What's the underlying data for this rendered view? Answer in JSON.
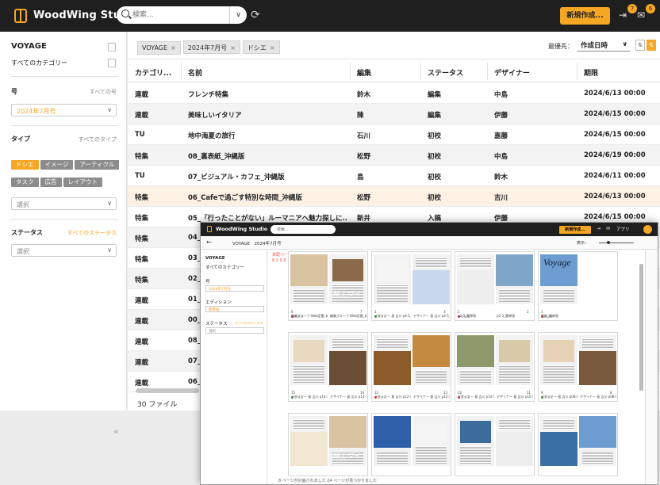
{
  "topbar": {
    "brand": "WoodWing Studio",
    "search_placeholder": "検索...",
    "new_button": "新規作成...",
    "badge_a": "7",
    "badge_b": "6"
  },
  "sidebar": {
    "title": "VOYAGE",
    "all_categories": "すべてのカテゴリー",
    "issue_label": "号",
    "issue_link": "すべての号",
    "issue_value": "2024年7月号",
    "type_label": "タイプ",
    "type_link": "すべてのタイプ",
    "type_chips": [
      {
        "label": "ドシエ",
        "active": true
      },
      {
        "label": "イメージ",
        "active": false
      },
      {
        "label": "アーティクル",
        "active": false
      },
      {
        "label": "タスク",
        "active": false
      },
      {
        "label": "広告",
        "active": false
      },
      {
        "label": "レイアウト",
        "active": false
      }
    ],
    "type_select_placeholder": "選択",
    "status_label": "ステータス",
    "status_link": "すべてのステータス",
    "status_select_placeholder": "選択"
  },
  "filters": [
    "VOYAGE",
    "2024年7月号",
    "ドシエ"
  ],
  "sort": {
    "label": "最優先：",
    "value": "作成日時"
  },
  "table": {
    "headers": [
      "カテゴリ...",
      "名前",
      "編集",
      "ステータス",
      "デザイナー",
      "期限"
    ],
    "rows": [
      [
        "連載",
        "フレンチ特集",
        "鈴木",
        "編集",
        "中島",
        "2024/6/13 00:00"
      ],
      [
        "連載",
        "美味しいイタリア",
        "陳",
        "編集",
        "伊藤",
        "2024/6/15 00:00"
      ],
      [
        "TU",
        "地中海夏の旅行",
        "石川",
        "初校",
        "嘉藤",
        "2024/6/15 00:00"
      ],
      [
        "特集",
        "08_裏表紙_沖縄版",
        "松野",
        "初校",
        "中島",
        "2024/6/19 00:00"
      ],
      [
        "TU",
        "07_ビジュアル・カフェ_沖縄版",
        "島",
        "初校",
        "鈴木",
        "2024/6/11 00:00"
      ],
      [
        "特集",
        "06_Cafeで過ごす特別な時間_沖縄版",
        "松野",
        "初校",
        "吉川",
        "2024/6/13 00:00"
      ],
      [
        "特集",
        "05_「行ったことがない」ルーマニアへ魅力探しに...",
        "新井",
        "入稿",
        "伊藤",
        "2024/6/15 00:00"
      ],
      [
        "特集",
        "04_",
        "",
        "",
        "",
        ""
      ],
      [
        "特集",
        "03_",
        "",
        "",
        "",
        ""
      ],
      [
        "特集",
        "02_",
        "",
        "",
        "",
        ""
      ],
      [
        "連載",
        "01_",
        "",
        "",
        "",
        ""
      ],
      [
        "連載",
        "00_",
        "",
        "",
        "",
        ""
      ],
      [
        "連載",
        "08_",
        "",
        "",
        "",
        ""
      ],
      [
        "連載",
        "07_",
        "",
        "",
        "",
        ""
      ],
      [
        "連載",
        "06_",
        "",
        "",
        "",
        ""
      ]
    ]
  },
  "file_count": "30 ファイル",
  "layout_window": {
    "brand": "WoodWing Studio",
    "search_placeholder": "検索...",
    "new_button": "新規作成...",
    "apps": "アプリ",
    "breadcrumb": "VOYAGE　2024年7月号",
    "display": "表示：",
    "side_title": "VOYAGE",
    "side_categories": "すべてのカテゴリー",
    "issue_label": "号",
    "issue_value": "2024年7月号",
    "edition_label": "エディション",
    "edition_value": "標準版",
    "status_label": "ステータス",
    "status_link": "すべてのステータス",
    "status_placeholder": "選択",
    "grid_label_1": "未配ページ",
    "grid_label_2": "8 2 0 8",
    "cover_title": "Voyage",
    "status_line": "8 ページが計画されました 24 ページが見つかりました",
    "spreads": [
      {
        "left_num": "6",
        "right_num": "7",
        "caption_left": "編集グループ\nWeb定番_bodyでの出力",
        "caption_right": "編集グループ\nWeb定番_bodyでの出力"
      },
      {
        "left_num": "2",
        "right_num": "3",
        "caption_left": "デザイナー 島 吉川\np4-5_簡単版",
        "caption_right": "デザイナー 島 吉川\np4-5_簡単版"
      },
      {
        "left_num": "2",
        "right_num": "3",
        "caption_left": "p2-3_簡単版",
        "caption_right": "p2-3_簡単版"
      },
      {
        "left_num": "1",
        "right_num": "",
        "caption_left": "表紙_簡単版",
        "caption_right": ""
      },
      {
        "left_num": "15",
        "right_num": "14",
        "caption_left": "デザイナー 島 吉川\np14-15_簡単版",
        "caption_right": "デザイナー 島 吉川\np14-15_簡単版"
      },
      {
        "left_num": "12",
        "right_num": "13",
        "caption_left": "デザイナー 島 吉川\np12-13_簡単版",
        "caption_right": "デザイナー 島 吉川\np12-13_簡単版"
      },
      {
        "left_num": "10",
        "right_num": "11",
        "caption_left": "デザイナー 島 吉川\np10-11_簡単版",
        "caption_right": "デザイナー 島 吉川\np10-11_簡単版"
      },
      {
        "left_num": "9",
        "right_num": "8",
        "caption_left": "デザイナー 島 吉川\np08-09_簡単版",
        "caption_right": "デザイナー 島 吉川\np08-09_簡単版"
      }
    ],
    "overlay_text": "極上ワイン"
  }
}
